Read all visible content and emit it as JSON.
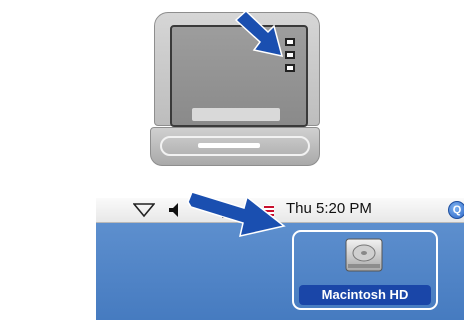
{
  "menubar": {
    "clock": "Thu 5:20 PM",
    "icons": [
      "airport-icon",
      "volume-icon",
      "battery-icon",
      "flag-icon",
      "spotlight-icon"
    ],
    "spotlight_glyph": "Q"
  },
  "desktop": {
    "hard_disk_label": "Macintosh HD",
    "hard_disk_icon": "hard-disk-icon"
  },
  "illustration": {
    "monitor_icon": "computer-icon",
    "arrow_color": "#1a4fb0",
    "screen_icons": [
      "drive-icon",
      "drive-icon",
      "drive-icon"
    ]
  },
  "colors": {
    "desktop_blue": "#4f85c7",
    "selection_blue": "#1a46a8",
    "arrow_blue": "#1a4fb0"
  }
}
